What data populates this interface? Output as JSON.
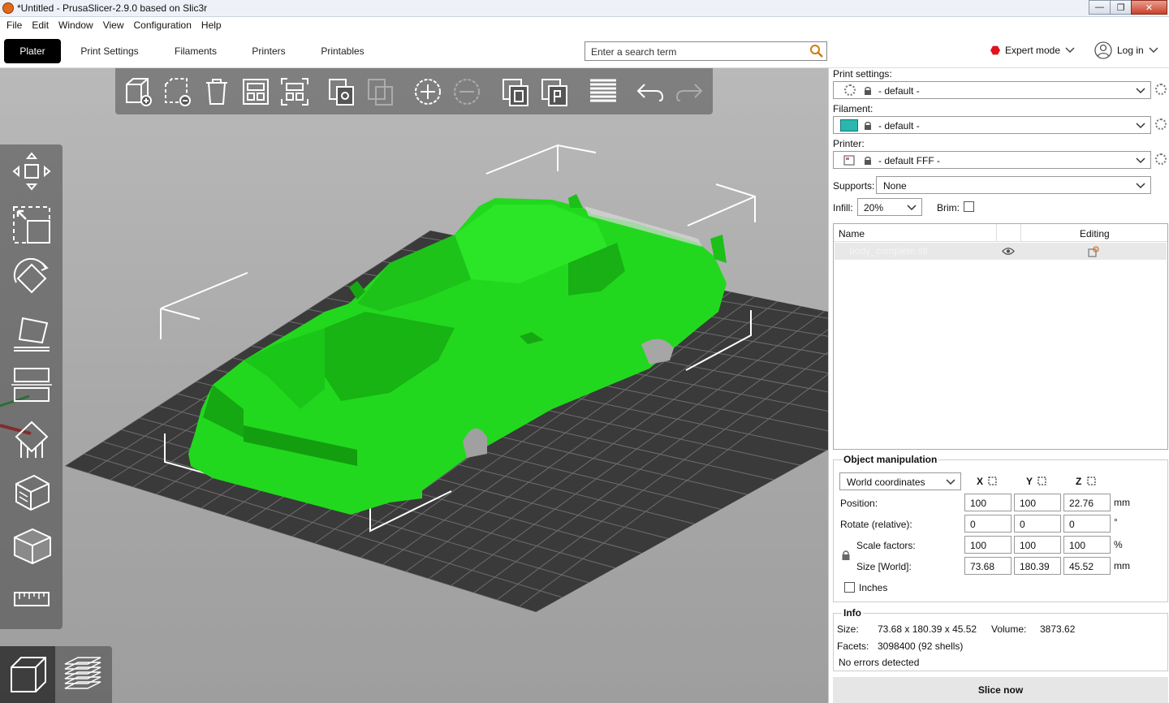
{
  "window": {
    "title": "*Untitled - PrusaSlicer-2.9.0 based on Slic3r",
    "controls": [
      "—",
      "❐",
      "✕"
    ]
  },
  "menu": [
    "File",
    "Edit",
    "Window",
    "View",
    "Configuration",
    "Help"
  ],
  "tabs": [
    "Plater",
    "Print Settings",
    "Filaments",
    "Printers",
    "Printables"
  ],
  "search": {
    "placeholder": "Enter a search term"
  },
  "mode": {
    "label": "Expert mode",
    "color": "#e0121e"
  },
  "account": {
    "label": "Log in"
  },
  "colors": {
    "model": "#22d81e",
    "filament": "#2bb7b0",
    "bed": "#3a3a3a"
  },
  "toolbar_top": [
    "add-icon",
    "delete-icon",
    "delete-all-icon",
    "arrange-icon",
    "arrange-selection-icon",
    "copy-icon",
    "paste-icon",
    "add-instance-icon",
    "remove-instance-icon",
    "split-to-objects-icon",
    "split-to-parts-icon",
    "layers-editing-icon",
    "undo-icon",
    "redo-icon"
  ],
  "toolbar_left": [
    "move-icon",
    "scale-icon",
    "rotate-icon",
    "place-on-face-icon",
    "cut-icon",
    "support-painting-icon",
    "seam-painting-icon",
    "mmu-painting-icon",
    "measure-icon"
  ],
  "view_buttons": [
    "3d-view-icon",
    "preview-icon"
  ],
  "settings": {
    "print_label": "Print settings:",
    "print_value": "- default -",
    "filament_label": "Filament:",
    "filament_value": "- default -",
    "printer_label": "Printer:",
    "printer_value": "- default FFF -",
    "supports_label": "Supports:",
    "supports_value": "None",
    "infill_label": "Infill:",
    "infill_value": "20%",
    "brim_label": "Brim:"
  },
  "object_list": {
    "col_name": "Name",
    "col_editing": "Editing",
    "rows": [
      {
        "name": "body_complete.stl"
      }
    ]
  },
  "manipulation": {
    "title": "Object manipulation",
    "coords": "World coordinates",
    "axes": [
      "X",
      "Y",
      "Z"
    ],
    "position_label": "Position:",
    "position": [
      "100",
      "100",
      "22.76"
    ],
    "position_unit": "mm",
    "rotate_label": "Rotate (relative):",
    "rotate": [
      "0",
      "0",
      "0"
    ],
    "rotate_unit": "°",
    "scale_label": "Scale factors:",
    "scale": [
      "100",
      "100",
      "100"
    ],
    "scale_unit": "%",
    "size_label": "Size [World]:",
    "size": [
      "73.68",
      "180.39",
      "45.52"
    ],
    "size_unit": "mm",
    "inches_label": "Inches"
  },
  "info": {
    "title": "Info",
    "size_label": "Size:",
    "size_value": "73.68 x 180.39 x 45.52",
    "volume_label": "Volume:",
    "volume_value": "3873.62",
    "facets_label": "Facets:",
    "facets_value": "3098400 (92 shells)",
    "errors": "No errors detected"
  },
  "slice_button": "Slice now"
}
